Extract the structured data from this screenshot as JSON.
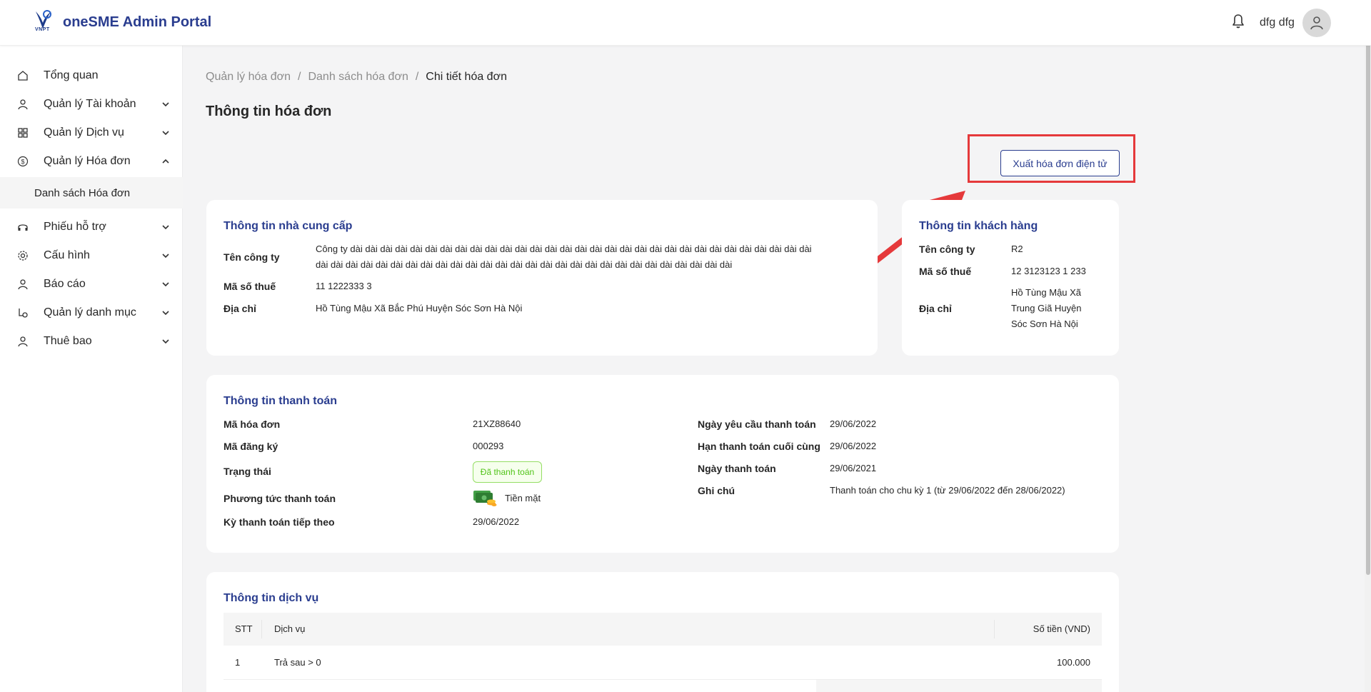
{
  "header": {
    "logo_text": "VNPT",
    "app_title": "oneSME Admin Portal",
    "user_name": "dfg dfg",
    "icons": {
      "notification": "bell-icon",
      "user": "user-icon"
    }
  },
  "sidebar": {
    "items": [
      {
        "label": "Tổng quan",
        "icon": "home-icon",
        "expandable": false
      },
      {
        "label": "Quản lý Tài khoản",
        "icon": "user-icon",
        "expandable": true
      },
      {
        "label": "Quản lý Dịch vụ",
        "icon": "grid-icon",
        "expandable": true
      },
      {
        "label": "Quản lý Hóa đơn",
        "icon": "dollar-circle-icon",
        "expandable": true,
        "expanded": true
      },
      {
        "label": "Danh sách Hóa đơn",
        "submenu": true,
        "active": true
      },
      {
        "label": "Phiếu hỗ trợ",
        "icon": "headset-icon",
        "expandable": true
      },
      {
        "label": "Cấu hình",
        "icon": "gear-icon",
        "expandable": true
      },
      {
        "label": "Báo cáo",
        "icon": "user-icon",
        "expandable": true
      },
      {
        "label": "Quản lý danh mục",
        "icon": "category-icon",
        "expandable": true
      },
      {
        "label": "Thuê bao",
        "icon": "user-icon",
        "expandable": true
      }
    ]
  },
  "breadcrumb": [
    "Quản lý hóa đơn",
    "Danh sách hóa đơn",
    "Chi tiết hóa đơn"
  ],
  "breadcrumb_separator": "/",
  "page_title": "Thông tin hóa đơn",
  "export_button": "Xuất hóa đơn điện tử",
  "supplier": {
    "title": "Thông tin nhà cung cấp",
    "company_label": "Tên công ty",
    "company_line1": "Công ty dài dài dài dài dài dài dài dài dài dài dài dài dài dài dài dài dài dài dài dài dài dài dài dài dài dài dài dài dài dài dài",
    "company_line2": "dài dài dài dài dài dài dài dài dài dài dài dài dài dài dài dài dài dài dài dài dài dài dài dài dài dài dài dài",
    "tax_label": "Mã số thuế",
    "tax_value": "11 1222333 3",
    "address_label": "Địa chỉ",
    "address_value": "Hồ Tùng Mậu Xã Bắc Phú Huyện Sóc Sơn Hà Nội"
  },
  "customer": {
    "title": "Thông tin khách hàng",
    "company_label": "Tên công ty",
    "company_value": "R2",
    "tax_label": "Mã số thuế",
    "tax_value": "12 3123123 1 233",
    "address_label": "Địa chỉ",
    "address_lines": [
      "Hồ Tùng Mậu Xã",
      "Trung Giã Huyện",
      "Sóc Sơn Hà Nội"
    ]
  },
  "payment": {
    "title": "Thông tin thanh toán",
    "invoice_code_label": "Mã hóa đơn",
    "invoice_code": "21XZ88640",
    "registration_label": "Mã đăng ký",
    "registration_code": "000293",
    "status_label": "Trạng thái",
    "status_value": "Đã thanh toán",
    "status_color": "#52c41a",
    "method_label": "Phương tức thanh toán",
    "method_value": "Tiền mặt",
    "method_icon": "cash-icon",
    "next_period_label": "Kỳ thanh toán tiếp theo",
    "next_period": "29/06/2022",
    "request_date_label": "Ngày yêu cầu thanh toán",
    "request_date": "29/06/2022",
    "deadline_label": "Hạn thanh toán cuối cùng",
    "deadline": "29/06/2022",
    "paid_date_label": "Ngày thanh toán",
    "paid_date": "29/06/2021",
    "note_label": "Ghi chú",
    "note": "Thanh toán cho chu kỳ 1 (từ 29/06/2022 đến 28/06/2022)"
  },
  "services": {
    "title": "Thông tin dịch vụ",
    "columns": [
      "STT",
      "Dịch vụ",
      "Số tiền (VND)"
    ],
    "rows": [
      {
        "stt": "1",
        "service": "Trả sau > 0",
        "amount": "100.000"
      }
    ]
  },
  "colors": {
    "brand": "#2a3d8f",
    "annotation": "#e5393b",
    "success": "#52c41a"
  }
}
